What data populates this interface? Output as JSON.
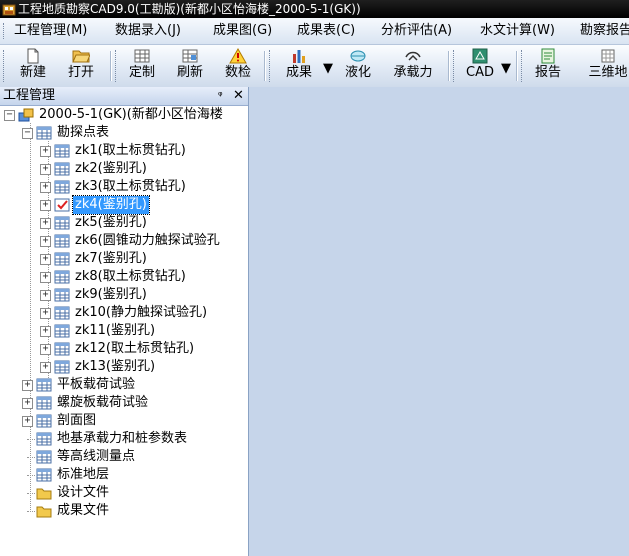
{
  "window": {
    "title": "工程地质勘察CAD9.0(工勘版)(新都小区怡海楼_2000-5-1(GK))"
  },
  "menu": [
    "工程管理(M)",
    "数据录入(J)",
    "成果图(G)",
    "成果表(C)",
    "分析评估(A)",
    "水文计算(W)",
    "勘察报告"
  ],
  "toolbar": {
    "new": "新建",
    "open": "打开",
    "customize": "定制",
    "refresh": "刷新",
    "numeric_check": "数检",
    "results": "成果",
    "liquefaction": "液化",
    "bearing": "承载力",
    "cad": "CAD",
    "report": "报告",
    "three_d": "三维地"
  },
  "panel": {
    "title": "工程管理",
    "pin": "ᵠ",
    "close": "✕"
  },
  "tree": {
    "root": "2000-5-1(GK)(新都小区怡海楼",
    "survey_points": "勘探点表",
    "boreholes": [
      "zk1(取土标贯钻孔)",
      "zk2(鉴别孔)",
      "zk3(取土标贯钻孔)",
      "zk4(鉴别孔)",
      "zk5(鉴别孔)",
      "zk6(圆锥动力触探试验孔",
      "zk7(鉴别孔)",
      "zk8(取土标贯钻孔)",
      "zk9(鉴别孔)",
      "zk10(静力触探试验孔)",
      "zk11(鉴别孔)",
      "zk12(取土标贯钻孔)",
      "zk13(鉴别孔)"
    ],
    "selected_index": 3,
    "others": [
      "平板载荷试验",
      "螺旋板载荷试验",
      "剖面图",
      "地基承载力和桩参数表",
      "等高线测量点",
      "标准地层",
      "设计文件",
      "成果文件"
    ]
  }
}
